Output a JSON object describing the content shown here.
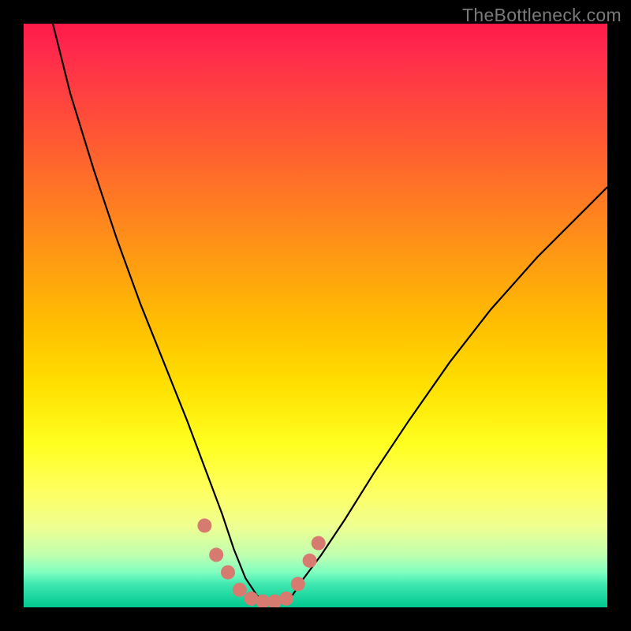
{
  "watermark": "TheBottleneck.com",
  "chart_data": {
    "type": "line",
    "title": "",
    "xlabel": "",
    "ylabel": "",
    "xlim": [
      0,
      100
    ],
    "ylim": [
      0,
      100
    ],
    "grid": false,
    "legend": false,
    "description": "Bottleneck curve: V-shaped black line over vertical rainbow gradient (red top = high bottleneck, green bottom = optimal). Minimum near x≈38–45. Coral marker dots trace the region near the minimum.",
    "series": [
      {
        "name": "bottleneck-curve",
        "x": [
          5,
          8,
          12,
          16,
          20,
          24,
          28,
          31,
          34,
          36,
          38,
          40,
          42,
          44,
          46,
          48,
          51,
          55,
          60,
          66,
          73,
          80,
          88,
          96,
          100
        ],
        "y": [
          100,
          88,
          75,
          63,
          52,
          42,
          32,
          24,
          16,
          10,
          5,
          2,
          1,
          1,
          2,
          5,
          9,
          15,
          23,
          32,
          42,
          51,
          60,
          68,
          72
        ]
      }
    ],
    "markers": {
      "name": "highlight-dots",
      "color": "#d77a6f",
      "x": [
        31,
        33,
        35,
        37,
        39,
        41,
        43,
        45,
        47,
        49,
        50.5
      ],
      "y": [
        14,
        9,
        6,
        3,
        1.5,
        1,
        1,
        1.5,
        4,
        8,
        11
      ]
    },
    "gradient_stops": [
      {
        "pct": 0,
        "color": "#ff1a4a"
      },
      {
        "pct": 50,
        "color": "#ffd000"
      },
      {
        "pct": 80,
        "color": "#ffff60"
      },
      {
        "pct": 100,
        "color": "#00c890"
      }
    ]
  }
}
